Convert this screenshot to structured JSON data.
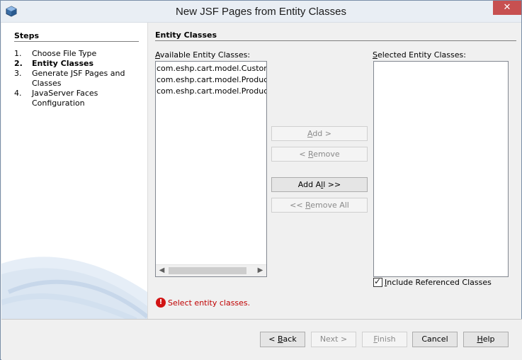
{
  "window": {
    "title": "New JSF Pages from Entity Classes"
  },
  "steps": {
    "title": "Steps",
    "items": [
      {
        "num": "1.",
        "label": "Choose File Type"
      },
      {
        "num": "2.",
        "label": "Entity Classes"
      },
      {
        "num": "3.",
        "label": "Generate JSF Pages and Classes"
      },
      {
        "num": "4.",
        "label": "JavaServer Faces Configuration"
      }
    ]
  },
  "main": {
    "section_title": "Entity Classes",
    "available_label_u": "A",
    "available_label_rest": "vailable Entity Classes:",
    "selected_label_u": "S",
    "selected_label_rest": "elected Entity Classes:",
    "available_items": [
      "com.eshp.cart.model.Customer",
      "com.eshp.cart.model.Product",
      "com.eshp.cart.model.ProductOrder"
    ],
    "include_label_u": "I",
    "include_label_rest": "nclude Referenced Classes",
    "include_checked": true,
    "error_text": "Select entity classes."
  },
  "buttons": {
    "add_u": "A",
    "add_rest": "dd >",
    "remove_pre": "< ",
    "remove_u": "R",
    "remove_rest": "emove",
    "addall_pre": "Add A",
    "addall_u": "l",
    "addall_rest": "l >>",
    "removeall_pre": "<< ",
    "removeall_u": "R",
    "removeall_rest": "emove All"
  },
  "footer": {
    "back_pre": "< ",
    "back_u": "B",
    "back_rest": "ack",
    "next": "Next >",
    "finish_u": "F",
    "finish_rest": "inish",
    "cancel": "Cancel",
    "help_u": "H",
    "help_rest": "elp"
  },
  "colors": {
    "error": "#c00000",
    "close_button": "#c75050"
  }
}
